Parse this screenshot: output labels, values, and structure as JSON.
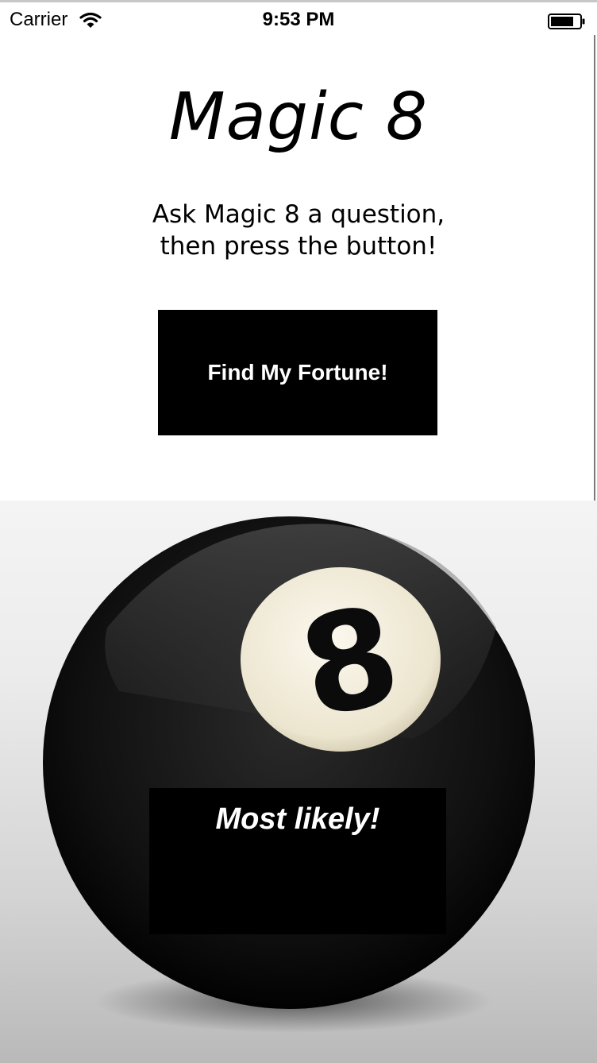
{
  "status_bar": {
    "carrier": "Carrier",
    "time": "9:53 PM",
    "icons": [
      "wifi-icon",
      "battery-icon"
    ]
  },
  "app": {
    "title": "Magic 8",
    "subtitle_line1": "Ask Magic 8 a question,",
    "subtitle_line2": "then press the button!",
    "button_label": "Find My Fortune!",
    "answer": "Most likely!",
    "ball_number": "8"
  },
  "colors": {
    "background": "#ffffff",
    "button": "#000000",
    "button_text": "#ffffff",
    "ball": "#111111",
    "ball_label": "#f1ecdc"
  }
}
